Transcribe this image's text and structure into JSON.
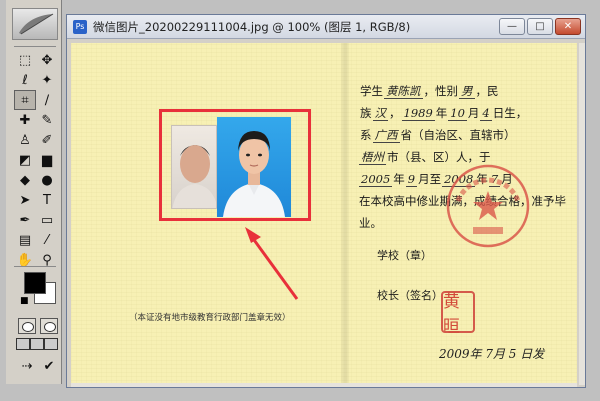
{
  "window": {
    "title": "微信图片_20200229111004.jpg @ 100% (图层 1, RGB/8)",
    "app_icon": "Ps",
    "minimize_label": "—",
    "maximize_label": "□",
    "close_label": "✕"
  },
  "tools": [
    {
      "name": "marquee-tool-icon",
      "glyph": "⬚"
    },
    {
      "name": "move-tool-icon",
      "glyph": "✥"
    },
    {
      "name": "lasso-tool-icon",
      "glyph": "ℓ"
    },
    {
      "name": "magic-wand-tool-icon",
      "glyph": "✦"
    },
    {
      "name": "crop-tool-icon",
      "glyph": "⌗"
    },
    {
      "name": "slice-tool-icon",
      "glyph": "∕"
    },
    {
      "name": "healing-brush-tool-icon",
      "glyph": "✚"
    },
    {
      "name": "brush-tool-icon",
      "glyph": "✎"
    },
    {
      "name": "clone-stamp-tool-icon",
      "glyph": "♙"
    },
    {
      "name": "history-brush-tool-icon",
      "glyph": "✐"
    },
    {
      "name": "eraser-tool-icon",
      "glyph": "◩"
    },
    {
      "name": "gradient-tool-icon",
      "glyph": "▆"
    },
    {
      "name": "blur-tool-icon",
      "glyph": "◆"
    },
    {
      "name": "dodge-tool-icon",
      "glyph": "●"
    },
    {
      "name": "path-selection-tool-icon",
      "glyph": "➤"
    },
    {
      "name": "type-tool-icon",
      "glyph": "T"
    },
    {
      "name": "pen-tool-icon",
      "glyph": "✒"
    },
    {
      "name": "shape-tool-icon",
      "glyph": "▭"
    },
    {
      "name": "notes-tool-icon",
      "glyph": "▤"
    },
    {
      "name": "eyedropper-tool-icon",
      "glyph": "⁄"
    },
    {
      "name": "hand-tool-icon",
      "glyph": "✋"
    },
    {
      "name": "zoom-tool-icon",
      "glyph": "⚲"
    }
  ],
  "colors": {
    "foreground": "#000000",
    "background": "#ffffff",
    "selection_frame": "#e8303a",
    "paper": "#f7f0b4"
  },
  "certificate": {
    "line1": {
      "a": "学生",
      "name": "黄陈凯",
      "b": "，性别",
      "gender": "男",
      "c": "，民"
    },
    "line2": {
      "a": "族",
      "ethnicity": "汉",
      "b": "，",
      "year": "1989",
      "c": "年",
      "month": "10",
      "d": "月",
      "day": "4",
      "e": "日生，"
    },
    "line3": {
      "a": "系",
      "province": "广西",
      "b": "省（自治区、直辖市）"
    },
    "line4": {
      "city": "梧州",
      "a": "市（县、区）人，于"
    },
    "line5": {
      "start_year": "2005",
      "a": "年",
      "start_month": "9",
      "b": "月至",
      "end_year": "2008",
      "c": "年",
      "end_month": "7",
      "d": "月"
    },
    "line6": "在本校高中修业期满，成绩合格，准予毕",
    "line7": "业。",
    "school_label": "学校（章）",
    "principal_label": "校长（签名）",
    "principal_seal": "黄晅",
    "issue_date": "2009年 7月 5 日发",
    "notice": "（本证没有地市级教育行政部门盖章无效）"
  }
}
